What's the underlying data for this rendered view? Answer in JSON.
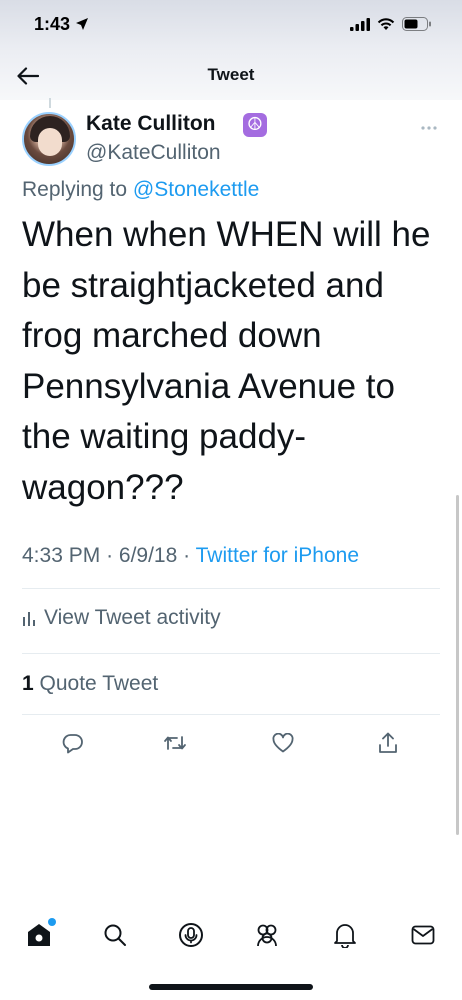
{
  "status_bar": {
    "time": "1:43"
  },
  "nav": {
    "title": "Tweet"
  },
  "tweet": {
    "display_name": "Kate Culliton",
    "name_emoji": "☮",
    "handle": "@KateCulliton",
    "replying_prefix": "Replying to",
    "replying_to": "@Stonekettle",
    "text": "When when WHEN will he be straightjacketed and frog marched down Pennsylvania Avenue to the waiting paddy-wagon???",
    "time": "4:33 PM",
    "date": "6/9/18",
    "separator": "·",
    "source": "Twitter for iPhone",
    "activity_label": "View Tweet activity",
    "quote_count": "1",
    "quote_label": "Quote Tweet"
  },
  "icons": {
    "back": "arrow-left-icon",
    "more": "more-icon",
    "reply": "reply-icon",
    "retweet": "retweet-icon",
    "like": "like-icon",
    "share": "share-icon",
    "activity": "activity-icon"
  },
  "tabs": [
    "home",
    "search",
    "spaces",
    "communities",
    "notifications",
    "messages"
  ],
  "colors": {
    "accent": "#1d9bf0",
    "text": "#0f1419",
    "secondary": "#536471",
    "badge": "#a46ce0"
  }
}
